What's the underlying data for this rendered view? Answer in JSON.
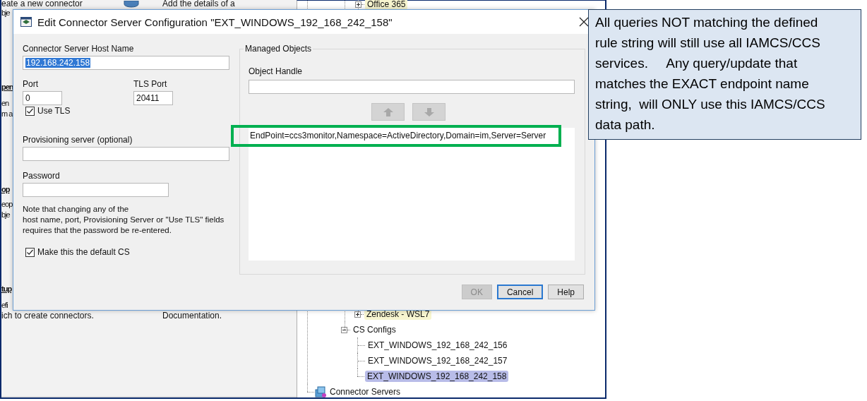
{
  "background_app": {
    "left_panel": {
      "column_1": [
        {
          "kind": "text",
          "text": "eate a new connector"
        },
        {
          "kind": "fragment",
          "text": "bje"
        },
        {
          "kind": "heading",
          "text": "pen"
        },
        {
          "kind": "fragment",
          "text": "en"
        },
        {
          "kind": "fragment",
          "text": "m a"
        },
        {
          "kind": "heading",
          "text": "op"
        },
        {
          "kind": "fragment",
          "text": "eop"
        },
        {
          "kind": "fragment",
          "text": "bje"
        },
        {
          "kind": "heading",
          "text": "tup"
        },
        {
          "kind": "fragment",
          "text": "efi"
        },
        {
          "kind": "text",
          "text": "ich to create connectors."
        }
      ],
      "column_2": [
        "Add the details of a",
        "Documentation."
      ]
    },
    "tree": {
      "nodes": [
        {
          "kind": "hidden",
          "children": [
            {
              "kind": "hidden",
              "children": [
                {
                  "kind": "node",
                  "label": "Office 365",
                  "expanded": false,
                  "highlighted": true,
                  "selected": false
                },
                {
                  "kind": "node",
                  "label": "Zendesk - WSL7",
                  "expanded": false,
                  "highlighted": true,
                  "selected": false
                }
              ]
            },
            {
              "kind": "node",
              "label": "CS Configs",
              "expanded": true,
              "highlighted": false,
              "selected": false,
              "children": [
                {
                  "kind": "leaf",
                  "label": "EXT_WINDOWS_192_168_242_156",
                  "highlighted": false,
                  "selected": false
                },
                {
                  "kind": "leaf",
                  "label": "EXT_WINDOWS_192_168_242_157",
                  "highlighted": false,
                  "selected": false
                },
                {
                  "kind": "leaf",
                  "label": "EXT_WINDOWS_192_168_242_158",
                  "highlighted": false,
                  "selected": true
                }
              ]
            }
          ]
        },
        {
          "kind": "server",
          "label": "Connector Servers",
          "highlighted": false,
          "selected": false
        }
      ]
    }
  },
  "dialog": {
    "title": "Edit Connector Server Configuration \"EXT_WINDOWS_192_168_242_158\"",
    "host_name": {
      "label": "Connector Server Host Name",
      "value": "192.168.242.158",
      "text_selected": true
    },
    "port": {
      "label": "Port",
      "value": "0"
    },
    "tls_port": {
      "label": "TLS Port",
      "value": "20411"
    },
    "use_tls": {
      "label": "Use TLS",
      "checked": true
    },
    "provisioning_server": {
      "label": "Provisioning server (optional)"
    },
    "password": {
      "label": "Password"
    },
    "note": "Note that changing any of the\nhost name, port, Provisioning Server or \"Use TLS\" fields\nrequires that the password be re-entered.",
    "default_cs": {
      "label": "Make this the default CS",
      "checked": true
    },
    "managed_objects": {
      "title": "Managed Objects",
      "object_handle": {
        "label": "Object Handle"
      },
      "move_up": {
        "disabled": true
      },
      "move_down": {
        "disabled": true
      },
      "entries": [
        {
          "text": "EndPoint=ccs3monitor,Namespace=ActiveDirectory,Domain=im,Server=Server",
          "selected": false
        }
      ]
    },
    "buttons": [
      {
        "label": "OK",
        "disabled": true,
        "focused": false
      },
      {
        "label": "Cancel",
        "disabled": false,
        "focused": true
      },
      {
        "label": "Help",
        "disabled": false,
        "focused": false
      }
    ]
  },
  "callout": {
    "text": "All queries NOT matching the defined\nrule string will still use all IAMCS/CCS\nservices.     Any query/update that\nmatches the EXACT endpoint name\nstring,  will ONLY use this IAMCS/CCS\ndata path."
  }
}
